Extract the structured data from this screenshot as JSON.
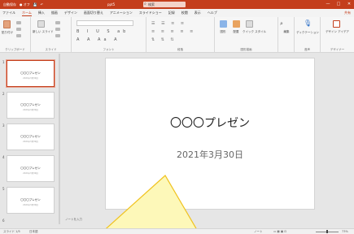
{
  "titlebar": {
    "autosave": "自動保存",
    "toggle": "● オフ",
    "save_icon": "save-icon",
    "undo_icon": "undo-icon",
    "filename": "ppt5",
    "search_placeholder": "検索",
    "window_controls": [
      "—",
      "□",
      "✕"
    ]
  },
  "tabs": {
    "items": [
      "ファイル",
      "ホーム",
      "挿入",
      "描画",
      "デザイン",
      "画面切り替え",
      "アニメーション",
      "スライドショー",
      "記録",
      "校閲",
      "表示",
      "ヘルプ"
    ],
    "active": "ホーム",
    "right_label": "共有"
  },
  "ribbon": {
    "clipboard": {
      "label": "クリップボード",
      "paste": "貼り付け"
    },
    "slides": {
      "label": "スライド",
      "new_slide": "新しい\nスライド"
    },
    "font": {
      "label": "フォント"
    },
    "paragraph": {
      "label": "段落"
    },
    "drawing": {
      "label": "図形描画",
      "shapes": "図形",
      "arrange": "配置",
      "quick_styles": "クイック\nスタイル"
    },
    "editing": {
      "label": "",
      "editing": "編集"
    },
    "voice": {
      "label": "音声",
      "dictate": "ディクテーション"
    },
    "designer": {
      "label": "デザイナー",
      "designer": "デザイン\nアイデア"
    }
  },
  "thumbnails": [
    {
      "num": "1",
      "title": "〇〇〇プレゼン",
      "sub": "2021年3月30日",
      "selected": true
    },
    {
      "num": "2",
      "title": "〇〇〇プレゼン",
      "sub": "2021年3月30日",
      "selected": false
    },
    {
      "num": "3",
      "title": "〇〇〇プレゼン",
      "sub": "2021年3月30日",
      "selected": false
    },
    {
      "num": "4",
      "title": "〇〇〇プレゼン",
      "sub": "2021年3月30日",
      "selected": false
    },
    {
      "num": "5",
      "title": "〇〇〇プレゼン",
      "sub": "2021年3月30日",
      "selected": false
    },
    {
      "num": "6",
      "title": "",
      "sub": "",
      "selected": false
    }
  ],
  "slide": {
    "title": "〇〇〇プレゼン",
    "date": "2021年3月30日"
  },
  "notes_placeholder": "ノートを入力",
  "status": {
    "slide_count": "スライド 1/5",
    "language": "日本語",
    "notes": "ノート",
    "zoom": "73%"
  },
  "colors": {
    "accent": "#c43e1c",
    "callout_fill": "#fdf8b9",
    "callout_stroke": "#f0c21e"
  }
}
